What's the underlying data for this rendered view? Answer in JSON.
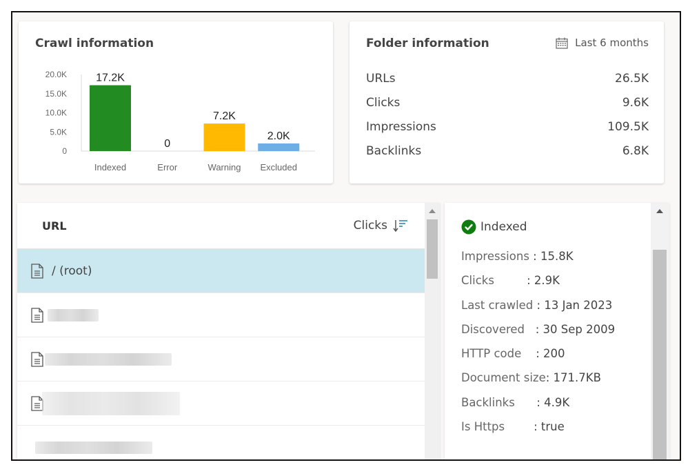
{
  "crawl_card": {
    "title": "Crawl information"
  },
  "chart_data": {
    "type": "bar",
    "title": "Crawl information",
    "categories": [
      "Indexed",
      "Error",
      "Warning",
      "Excluded"
    ],
    "values": [
      17200,
      0,
      7200,
      2000
    ],
    "value_labels": [
      "17.2K",
      "0",
      "7.2K",
      "2.0K"
    ],
    "colors": [
      "#228b22",
      "#228b22",
      "#ffb900",
      "#6eaee6"
    ],
    "ylim": [
      0,
      20000
    ],
    "yticks": [
      0,
      5000,
      10000,
      15000,
      20000
    ],
    "ytick_labels": [
      "0",
      "5.0K",
      "10.0K",
      "15.0K",
      "20.0K"
    ],
    "xlabel": "",
    "ylabel": "",
    "grid": false
  },
  "folder_card": {
    "title": "Folder information",
    "date_range": "Last 6 months",
    "date_icon": "calendar-icon",
    "stats": [
      {
        "label": "URLs",
        "value": "26.5K"
      },
      {
        "label": "Clicks",
        "value": "9.6K"
      },
      {
        "label": "Impressions",
        "value": "109.5K"
      },
      {
        "label": "Backlinks",
        "value": "6.8K"
      }
    ]
  },
  "url_list": {
    "col_url": "URL",
    "col_clicks": "Clicks",
    "sort_icon": "sort-descending-icon",
    "rows": [
      {
        "label": "/ (root)",
        "selected": true,
        "redacted": false
      },
      {
        "label": "",
        "redacted": true
      },
      {
        "label": "",
        "redacted": true
      },
      {
        "label": "",
        "redacted": true
      },
      {
        "label": "",
        "redacted": true
      }
    ]
  },
  "detail": {
    "status": "Indexed",
    "status_color": "#107c10",
    "fields": [
      {
        "label": "Impressions ",
        "value": ": 15.8K"
      },
      {
        "label": "Clicks         ",
        "value": ": 2.9K"
      },
      {
        "label": "Last crawled ",
        "value": ": 13 Jan 2023"
      },
      {
        "label": "Discovered   ",
        "value": ": 30 Sep 2009"
      },
      {
        "label": "HTTP code    ",
        "value": ": 200"
      },
      {
        "label": "Document size",
        "value": ": 171.7KB"
      },
      {
        "label": "Backlinks      ",
        "value": ": 4.9K"
      },
      {
        "label": "Is Https        ",
        "value": ": true"
      }
    ]
  }
}
